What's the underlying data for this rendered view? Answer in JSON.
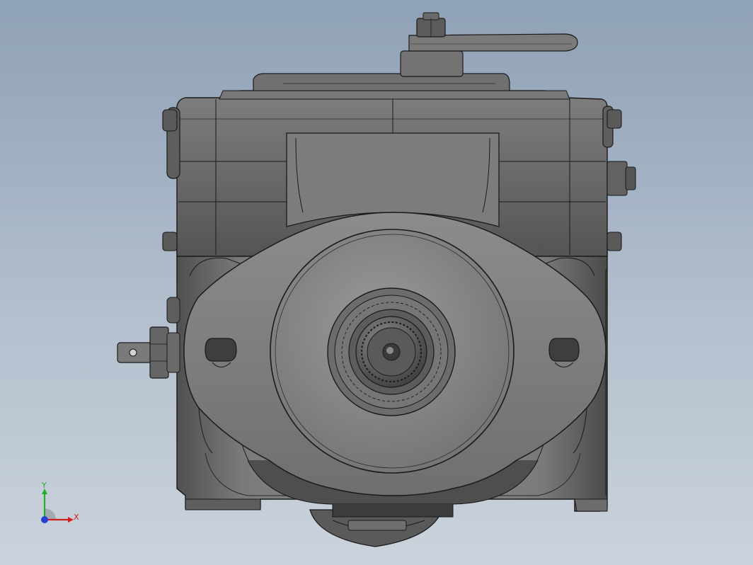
{
  "viewport": {
    "background_top": "#8fa1b6",
    "background_bottom": "#cbd3dc"
  },
  "model": {
    "part": "hydraulic-pump-front-view",
    "body_color": "#6a6a6a",
    "edge_color": "#1a1a1a"
  },
  "triad": {
    "x_label": "X",
    "y_label": "Y",
    "x_color": "#d21f1f",
    "y_color": "#1fae2a",
    "z_color": "#2440d8"
  }
}
